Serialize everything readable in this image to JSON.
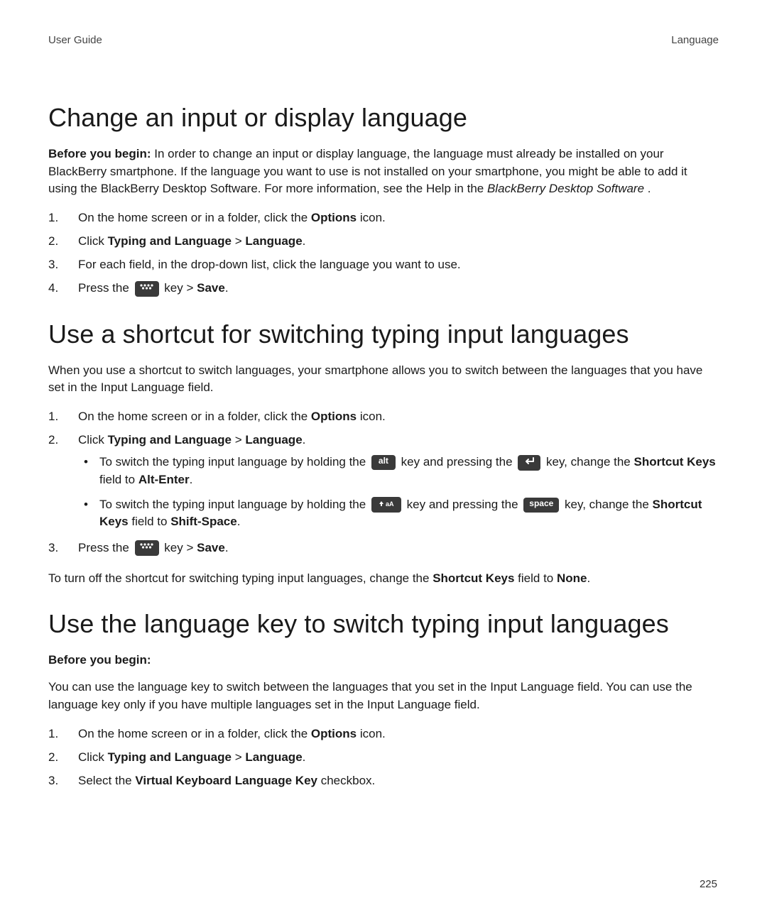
{
  "header": {
    "left": "User Guide",
    "right": "Language"
  },
  "page_number": "225",
  "inline": {
    "options": "Options",
    "typing_and_language": "Typing and Language",
    "language": "Language",
    "save": "Save",
    "shortcut_keys": "Shortcut Keys",
    "alt_enter": "Alt-Enter",
    "shift_space": "Shift-Space",
    "none": "None",
    "virtual_kb": "Virtual Keyboard Language Key",
    "key_alt": "alt",
    "key_space": "space",
    "bb_desktop_sw": "BlackBerry Desktop Software",
    "byb": "Before you begin:",
    "gt": " > "
  },
  "section1": {
    "heading": "Change an input or display language",
    "intro_after_byb": " In order to change an input or display language, the language must already be installed on your BlackBerry smartphone. If the language you want to use is not installed on your smartphone, you might be able to add it using the BlackBerry Desktop Software. For more information, see the Help in the ",
    "intro_tail": " .",
    "step1_a": "On the home screen or in a folder, click the ",
    "step1_b": " icon.",
    "step2_a": "Click ",
    "step2_b": ".",
    "step3": "For each field, in the drop-down list, click the language you want to use.",
    "step4_a": "Press the ",
    "step4_b": " key > ",
    "step4_c": "."
  },
  "section2": {
    "heading": "Use a shortcut for switching typing input languages",
    "intro": "When you use a shortcut to switch languages, your smartphone allows you to switch between the languages that you have set in the Input Language field.",
    "step1_a": "On the home screen or in a folder, click the ",
    "step1_b": " icon.",
    "step2_a": "Click ",
    "step2_b": ".",
    "bullet1_a": "To switch the typing input language by holding the ",
    "bullet1_b": " key and pressing the ",
    "bullet1_c": " key, change the ",
    "bullet1_d": " field to ",
    "bullet1_e": ".",
    "bullet2_a": "To switch the typing input language by holding the ",
    "bullet2_b": " key and pressing the ",
    "bullet2_c": " key, change the ",
    "bullet2_d": " field to ",
    "bullet2_e": ".",
    "step3_a": "Press the ",
    "step3_b": " key > ",
    "step3_c": ".",
    "footnote_a": "To turn off the shortcut for switching typing input languages, change the ",
    "footnote_b": " field to ",
    "footnote_c": "."
  },
  "section3": {
    "heading": "Use the language key to switch typing input languages",
    "intro": "You can use the language key to switch between the languages that you set in the Input Language field. You can use the language key only if you have multiple languages set in the Input Language field.",
    "step1_a": "On the home screen or in a folder, click the ",
    "step1_b": " icon.",
    "step2_a": "Click ",
    "step2_b": ".",
    "step3_a": "Select the ",
    "step3_b": " checkbox."
  }
}
